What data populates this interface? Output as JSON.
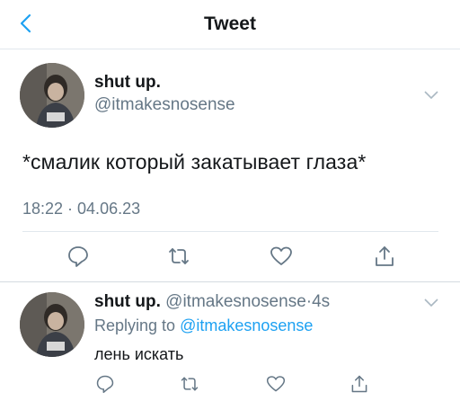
{
  "header": {
    "title": "Tweet",
    "back_icon": "chevron-left-icon"
  },
  "main_tweet": {
    "author_name": "shut up.",
    "author_handle": "@itmakesnosense",
    "text": "*смалик который закатывает глаза*",
    "timestamp": "18:22 · 04.06.23",
    "actions": [
      "reply-icon",
      "retweet-icon",
      "like-icon",
      "share-icon"
    ]
  },
  "reply_tweet": {
    "author_name": "shut up.",
    "author_handle": "@itmakesnosense",
    "separator": "·",
    "time_ago": "4s",
    "replying_prefix": "Replying to",
    "replying_handle": "@itmakesnosense",
    "text": "лень искать",
    "actions": [
      "reply-icon",
      "retweet-icon",
      "like-icon",
      "share-icon"
    ]
  },
  "colors": {
    "accent": "#1da1f2",
    "secondary_text": "#657786",
    "divider": "#e1e8ed"
  }
}
